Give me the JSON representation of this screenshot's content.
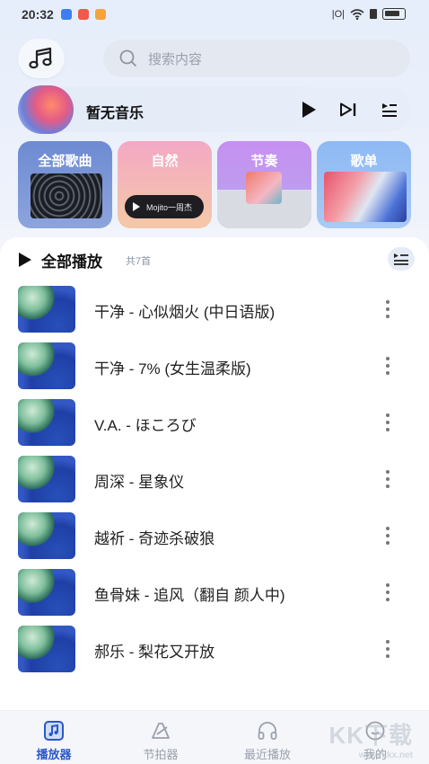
{
  "status": {
    "time": "20:32",
    "right_text": "|O|"
  },
  "search": {
    "placeholder": "搜索内容"
  },
  "now_playing": {
    "title": "暂无音乐"
  },
  "categories": [
    {
      "label": "全部歌曲"
    },
    {
      "label": "自然",
      "sub": "Mojito一周杰"
    },
    {
      "label": "节奏"
    },
    {
      "label": "歌单"
    }
  ],
  "playlist": {
    "title": "全部播放",
    "count": "共7首",
    "songs": [
      {
        "name": "干净 - 心似烟火 (中日语版)"
      },
      {
        "name": "干净 - 7% (女生温柔版)"
      },
      {
        "name": "V.A. - ほころび"
      },
      {
        "name": "周深 - 星象仪"
      },
      {
        "name": "越祈 - 奇迹杀破狼"
      },
      {
        "name": "鱼骨妹 - 追风（翻自 颜人中)"
      },
      {
        "name": "郝乐 - 梨花又开放"
      }
    ]
  },
  "nav": {
    "items": [
      {
        "label": "播放器",
        "icon": "music-box-icon",
        "active": true
      },
      {
        "label": "节拍器",
        "icon": "metronome-icon"
      },
      {
        "label": "最近播放",
        "icon": "headphones-icon"
      },
      {
        "label": "我的",
        "icon": "profile-icon"
      }
    ]
  },
  "watermark": {
    "main": "KK下载",
    "sub": "www.kkx.net"
  },
  "colors": {
    "accent": "#2a58c9",
    "panel": "#ffffff",
    "background": "#e6eefb"
  }
}
